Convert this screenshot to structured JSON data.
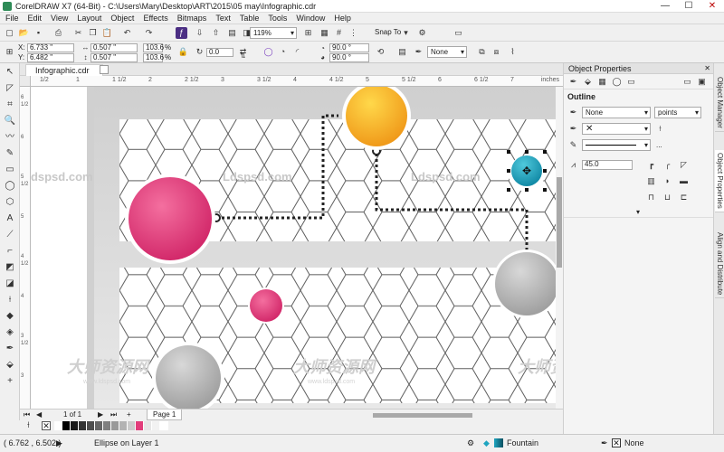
{
  "window": {
    "title": "CorelDRAW X7 (64-Bit) - C:\\Users\\Mary\\Desktop\\ART\\2015\\05 may\\Infographic.cdr",
    "min_glyph": "—",
    "max_glyph": "☐",
    "close_glyph": "✕"
  },
  "menu": [
    "File",
    "Edit",
    "View",
    "Layout",
    "Object",
    "Effects",
    "Bitmaps",
    "Text",
    "Table",
    "Tools",
    "Window",
    "Help"
  ],
  "standard_toolbar": {
    "zoom_value": "119%",
    "snap_to_label": "Snap To"
  },
  "property_bar": {
    "x_label": "X:",
    "x_value": "6.733 \"",
    "y_label": "Y:",
    "y_value": "6.482 \"",
    "w_value": "0.507 \"",
    "h_value": "0.507 \"",
    "w_pct": "103.6",
    "h_pct": "103.6",
    "pct_unit": "%",
    "rotation_value": "0.0",
    "start_angle": "90.0 °",
    "end_angle": "90.0 °",
    "outline_value": "None"
  },
  "document": {
    "tab_name": "Infographic.cdr",
    "ruler_unit": "inches",
    "ruler_h_ticks": [
      "1/2",
      "1",
      "1 1/2",
      "2",
      "2 1/2",
      "3",
      "3 1/2",
      "4",
      "4 1/2",
      "5",
      "5 1/2",
      "6",
      "6 1/2",
      "7"
    ],
    "ruler_v_ticks": [
      "6 1/2",
      "6",
      "5 1/2",
      "5",
      "4 1/2",
      "4",
      "3 1/2",
      "3"
    ]
  },
  "watermarks": {
    "latin": "Ldspsd.com",
    "cjk": "大师资源网",
    "cjk_small": "www.ldspsd.com"
  },
  "artwork": {
    "colors": {
      "pink": "#e23d7b",
      "yellow": "#f4b623",
      "cyan": "#1fa5c0",
      "gray": "#b7b7b7",
      "hex_line": "#5c5c5c",
      "banner_shadow": "#cfcfcf"
    }
  },
  "page_nav": {
    "counter": "1 of 1",
    "page_tab": "Page 1",
    "first_glyph": "⏮",
    "prev_glyph": "◀",
    "next_glyph": "▶",
    "last_glyph": "⏭",
    "add_glyph": "+"
  },
  "palette_colors": [
    "#ffffff",
    "#000000",
    "#1a1a1a",
    "#333333",
    "#4d4d4d",
    "#666666",
    "#808080",
    "#999999",
    "#b3b3b3",
    "#cccccc",
    "#e23d7b",
    "#e6e6e6",
    "#f2f2f2",
    "#ffffff"
  ],
  "status": {
    "cursor_coords": "( 6.762 , 6.502 )",
    "selection_info": "Ellipse on Layer 1",
    "fill_label": "Fountain",
    "outline_label": "None"
  },
  "docker": {
    "title": "Object Properties",
    "section": "Outline",
    "width_value": "None",
    "units_value": "points",
    "miter_value": "45.0",
    "more_glyph": "..."
  },
  "side_tabs": [
    "Object Manager",
    "Object Properties",
    "Align and Distribute"
  ]
}
